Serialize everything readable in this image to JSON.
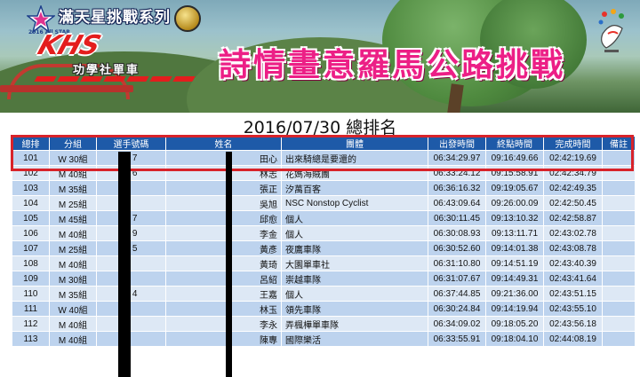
{
  "banner": {
    "series_title": "滿天星挑戰系列",
    "star_logo_text": "2016 All STAR",
    "sponsor_brand": "KHS",
    "sponsor_name": "功學社單車",
    "event_title": "詩情畫意羅馬公路挑戰"
  },
  "page_title": "2016/07/30 總排名",
  "table": {
    "columns": [
      "總排",
      "分組",
      "選手號碼",
      "姓名",
      "團體",
      "出發時間",
      "終點時間",
      "完成時間",
      "備註"
    ],
    "rows": [
      {
        "rank": "101",
        "group": "W 30組",
        "bib": "1  7",
        "name": "田心",
        "team": "出來騎總是要還的",
        "start": "06:34:29.97",
        "finish": "09:16:49.66",
        "total": "02:42:19.69",
        "note": ""
      },
      {
        "rank": "102",
        "group": "M 40組",
        "bib": "1  6",
        "name": "林志",
        "team": "花媽海賊團",
        "start": "06:33:24.12",
        "finish": "09:15:58.91",
        "total": "02:42:34.79",
        "note": ""
      },
      {
        "rank": "103",
        "group": "M 35組",
        "bib": "",
        "name": "張正",
        "team": "汐萬百客",
        "start": "06:36:16.32",
        "finish": "09:19:05.67",
        "total": "02:42:49.35",
        "note": ""
      },
      {
        "rank": "104",
        "group": "M 25組",
        "bib": "",
        "name": "吳旭",
        "team": "NSC Nonstop Cyclist",
        "start": "06:43:09.64",
        "finish": "09:26:00.09",
        "total": "02:42:50.45",
        "note": ""
      },
      {
        "rank": "105",
        "group": "M 45組",
        "bib": "6  7",
        "name": "邱愈",
        "team": "個人",
        "start": "06:30:11.45",
        "finish": "09:13:10.32",
        "total": "02:42:58.87",
        "note": ""
      },
      {
        "rank": "106",
        "group": "M 40組",
        "bib": "6  9",
        "name": "李金",
        "team": "個人",
        "start": "06:30:08.93",
        "finish": "09:13:11.71",
        "total": "02:43:02.78",
        "note": ""
      },
      {
        "rank": "107",
        "group": "M 25組",
        "bib": "1  5",
        "name": "黃彥",
        "team": "夜鷹車隊",
        "start": "06:30:52.60",
        "finish": "09:14:01.38",
        "total": "02:43:08.78",
        "note": ""
      },
      {
        "rank": "108",
        "group": "M 40組",
        "bib": "",
        "name": "黃琦",
        "team": "大園單車社",
        "start": "06:31:10.80",
        "finish": "09:14:51.19",
        "total": "02:43:40.39",
        "note": ""
      },
      {
        "rank": "109",
        "group": "M 30組",
        "bib": "",
        "name": "呂紹",
        "team": "崇越車隊",
        "start": "06:31:07.67",
        "finish": "09:14:49.31",
        "total": "02:43:41.64",
        "note": ""
      },
      {
        "rank": "110",
        "group": "M 35組",
        "bib": "6  4",
        "name": "王嘉",
        "team": "個人",
        "start": "06:37:44.85",
        "finish": "09:21:36.00",
        "total": "02:43:51.15",
        "note": ""
      },
      {
        "rank": "111",
        "group": "W 40組",
        "bib": "",
        "name": "林玉",
        "team": "領先車隊",
        "start": "06:30:24.84",
        "finish": "09:14:19.94",
        "total": "02:43:55.10",
        "note": ""
      },
      {
        "rank": "112",
        "group": "M 40組",
        "bib": "",
        "name": "李永",
        "team": "弄楓樺單車隊",
        "start": "06:34:09.02",
        "finish": "09:18:05.20",
        "total": "02:43:56.18",
        "note": ""
      },
      {
        "rank": "113",
        "group": "M 40組",
        "bib": "",
        "name": "陳專",
        "team": "國際樂活",
        "start": "06:33:55.91",
        "finish": "09:18:04.10",
        "total": "02:44:08.19",
        "note": ""
      }
    ]
  },
  "colors": {
    "header_blue": "#1e5aa8",
    "row_odd": "#bdd3ee",
    "row_even": "#dde8f5",
    "highlight_red": "#d8232a",
    "title_pink": "#ec1f86"
  }
}
